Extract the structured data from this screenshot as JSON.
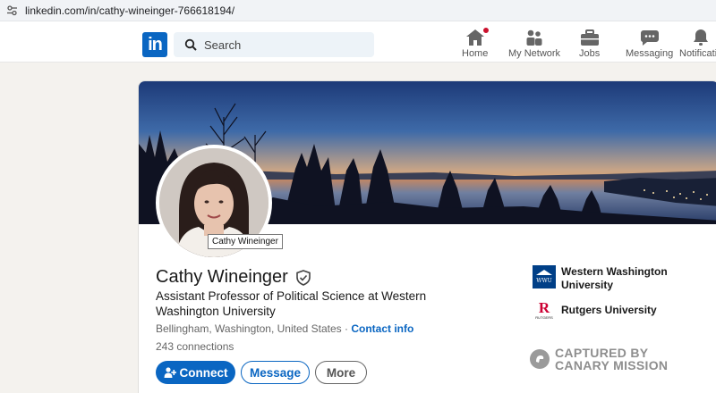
{
  "browser": {
    "url": "linkedin.com/in/cathy-wineinger-766618194/"
  },
  "nav": {
    "logo_text": "in",
    "search_placeholder": "Search",
    "items": [
      {
        "label": "Home",
        "icon": "home-icon"
      },
      {
        "label": "My Network",
        "icon": "network-icon"
      },
      {
        "label": "Jobs",
        "icon": "briefcase-icon"
      },
      {
        "label": "Messaging",
        "icon": "messaging-icon"
      },
      {
        "label": "Notificatio",
        "icon": "bell-icon"
      }
    ]
  },
  "colors": {
    "brand": "#0a66c2",
    "notification": "#cb112d",
    "wwu": "#003f87",
    "rutgers": "#cc0033"
  },
  "profile": {
    "name": "Cathy Wineinger",
    "avatar_tooltip": "Cathy Wineinger",
    "headline": "Assistant Professor of Political Science at Western Washington University",
    "location": "Bellingham, Washington, United States",
    "separator": " · ",
    "contact_info": "Contact info",
    "connections": "243 connections",
    "buttons": {
      "connect": "Connect",
      "message": "Message",
      "more": "More"
    },
    "education": [
      {
        "name": "Western Washington University",
        "logo_text": "WWU"
      },
      {
        "name": "Rutgers University",
        "logo_text": "RUTGERS"
      }
    ]
  },
  "watermark": {
    "line1": "CAPTURED BY",
    "line2": "CANARY MISSION"
  }
}
